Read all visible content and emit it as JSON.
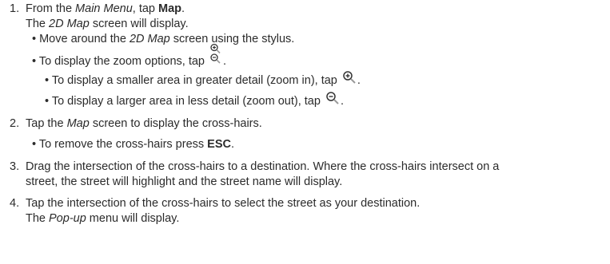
{
  "steps": [
    {
      "number": "1.",
      "line1": {
        "a": "From the ",
        "b": "Main Menu",
        "c": ", tap ",
        "d": "Map",
        "e": "."
      },
      "line2": {
        "a": "The ",
        "b": "2D Map",
        "c": " screen will display."
      },
      "bullet_move": {
        "a": "• Move around the ",
        "b": "2D Map",
        "c": " screen using the stylus."
      },
      "bullet_zoom_options": {
        "a": "• To display the zoom options, tap ",
        "b": "."
      },
      "bullet_zoom_in": {
        "a": "• To display a smaller area in greater detail (zoom in), tap ",
        "b": "."
      },
      "bullet_zoom_out": {
        "a": "• To display a larger area in less detail (zoom out), tap ",
        "b": "."
      }
    },
    {
      "number": "2.",
      "line1": {
        "a": "Tap the ",
        "b": "Map",
        "c": " screen to display the cross-hairs."
      },
      "bullet_remove": {
        "a": "• To remove the cross-hairs press ",
        "b": "ESC",
        "c": "."
      }
    },
    {
      "number": "3.",
      "line1": "Drag the intersection of the cross-hairs to a destination. Where the cross-hairs intersect on a",
      "line2": "street, the street will highlight and the street name will display."
    },
    {
      "number": "4.",
      "line1": "Tap the intersection of the cross-hairs to select the street as your destination.",
      "line2": {
        "a": "The ",
        "b": "Pop-up",
        "c": " menu will display."
      }
    }
  ],
  "icons": {
    "zoom_options": "zoom-options-icon",
    "zoom_in": "zoom-in-icon",
    "zoom_out": "zoom-out-icon"
  },
  "colors": {
    "text": "#2b2b2b",
    "icon_stroke": "#333333"
  }
}
